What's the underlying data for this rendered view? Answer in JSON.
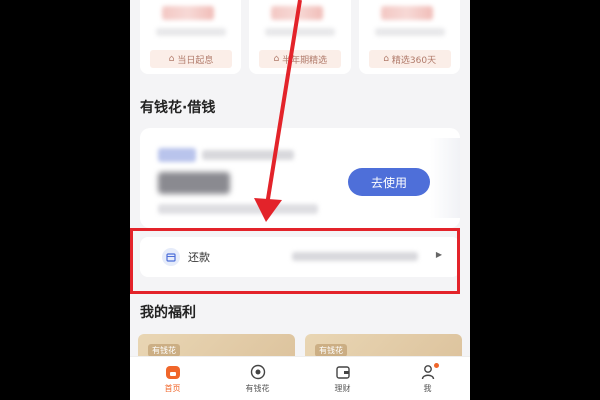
{
  "top_cards": [
    {
      "tag": "当日起息",
      "icon": "shield-icon"
    },
    {
      "tag": "半年期精选",
      "icon": "shield-icon"
    },
    {
      "tag": "精选360天",
      "icon": "shield-icon"
    }
  ],
  "borrow_section": {
    "title": "有钱花·借钱",
    "use_button": "去使用",
    "repay_label": "还款"
  },
  "welfare_section": {
    "title": "我的福利",
    "cards": [
      {
        "tag": "有钱花"
      },
      {
        "tag": "有钱花"
      }
    ]
  },
  "tabbar": {
    "items": [
      {
        "label": "首页",
        "icon": "home-icon",
        "active": true
      },
      {
        "label": "有钱花",
        "icon": "target-icon",
        "active": false
      },
      {
        "label": "理财",
        "icon": "wallet-icon",
        "active": false
      },
      {
        "label": "我",
        "icon": "user-icon",
        "active": false,
        "badge": true
      }
    ]
  },
  "colors": {
    "accent": "#f0662a",
    "button": "#4e6fd9",
    "highlight": "#e3232a"
  }
}
